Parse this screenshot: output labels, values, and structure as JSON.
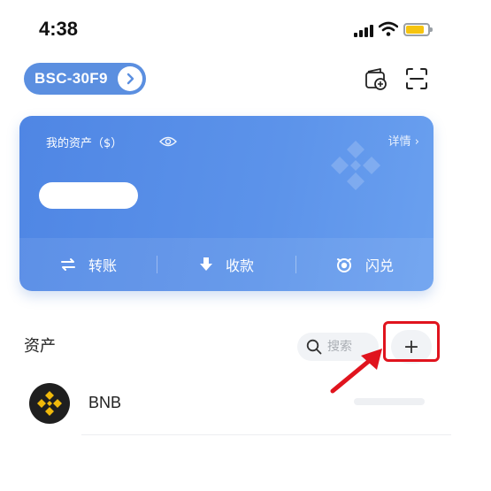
{
  "status_bar": {
    "time": "4:38"
  },
  "header": {
    "wallet_name": "BSC-30F9",
    "icons": [
      "wallet-add-icon",
      "scan-icon"
    ]
  },
  "asset_card": {
    "title": "我的资产（$）",
    "details_label": "详情 ›",
    "actions": [
      {
        "label": "转账",
        "icon": "transfer-icon"
      },
      {
        "label": "收款",
        "icon": "receive-icon"
      },
      {
        "label": "闪兑",
        "icon": "swap-icon"
      }
    ]
  },
  "assets_section": {
    "title": "资产",
    "search_placeholder": "搜索",
    "add_label": "+"
  },
  "tokens": [
    {
      "name": "BNB",
      "icon": "bnb-icon"
    }
  ],
  "colors": {
    "accent": "#5b8fe0",
    "card_gradient_start": "#4f86e4",
    "card_gradient_end": "#6aa0ef",
    "highlight": "#e0141e",
    "bnb_gold": "#f0b90b"
  }
}
